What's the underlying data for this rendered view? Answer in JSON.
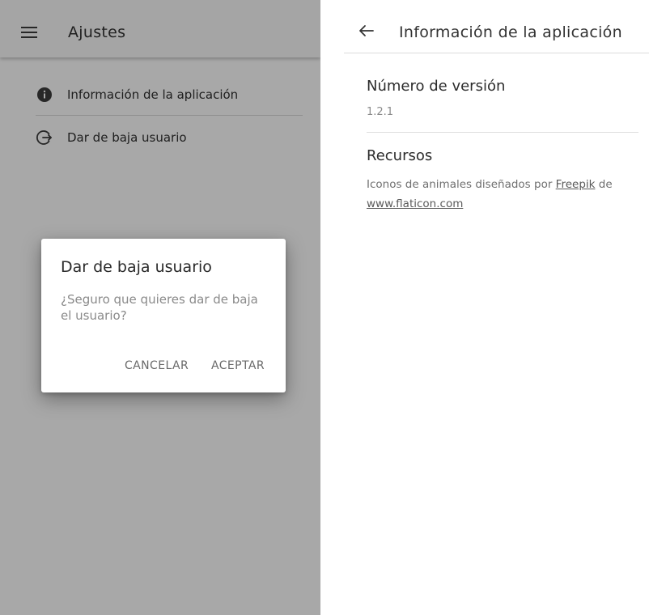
{
  "left_screen": {
    "toolbar": {
      "title": "Ajustes",
      "menu_icon": "menu-icon"
    },
    "items": [
      {
        "label": "Información de la aplicación",
        "icon": "info-icon"
      },
      {
        "label": "Dar de baja usuario",
        "icon": "logout-icon"
      }
    ],
    "dialog": {
      "title": "Dar de baja usuario",
      "message": "¿Seguro que quieres dar de baja el usuario?",
      "cancel_label": "CANCELAR",
      "accept_label": "ACEPTAR"
    }
  },
  "right_screen": {
    "toolbar": {
      "title": "Información de la aplicación",
      "back_icon": "back-arrow-icon"
    },
    "version": {
      "title": "Número de versión",
      "value": "1.2.1"
    },
    "resources": {
      "title": "Recursos",
      "text_before": "Iconos de animales diseñados por ",
      "link1": "Freepik",
      "text_middle": " de ",
      "link2": "www.flaticon.com"
    }
  },
  "colors": {
    "scrim": "#000000",
    "toolbar_bg": "#fafafa",
    "text_primary": "#2a2a2a",
    "text_secondary": "#8a8a8a"
  }
}
